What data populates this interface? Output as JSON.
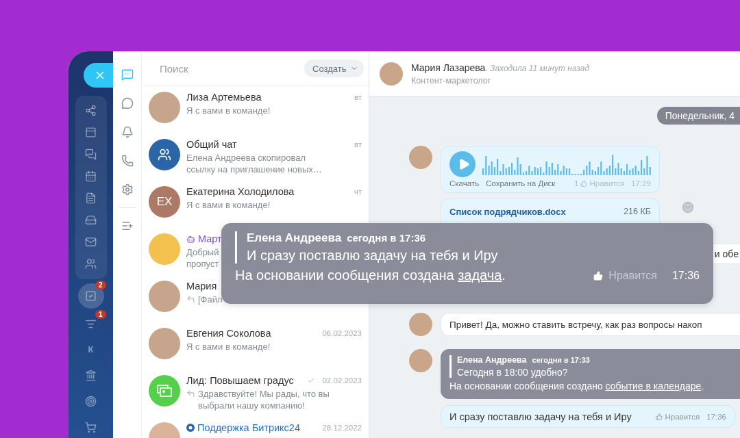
{
  "sidebar": {
    "items": [
      {
        "kind": "close"
      },
      {
        "kind": "group"
      },
      {
        "kind": "tasks",
        "badge": "2",
        "selected": true
      },
      {
        "kind": "filter",
        "badge": "1",
        "selected": false
      },
      {
        "kind": "letter",
        "label": "К",
        "selected": false
      },
      {
        "kind": "building",
        "selected": false
      },
      {
        "kind": "target",
        "selected": false
      },
      {
        "kind": "cart",
        "selected": false
      }
    ]
  },
  "icon_rail": [
    {
      "selected": true
    },
    {
      "selected": false
    },
    {
      "selected": false
    },
    {
      "selected": false
    },
    {
      "selected": false
    },
    {
      "selected": false
    }
  ],
  "chat_list": {
    "search": {
      "placeholder": "Поиск"
    },
    "create_button": "Создать",
    "items": [
      {
        "kind": "photo",
        "name": "Лиза Артемьева",
        "preview": [
          "Я с вами в команде!"
        ],
        "time": "вт",
        "reply": false,
        "read": false
      },
      {
        "kind": "group",
        "name": "Общий чат",
        "preview": [
          "Елена Андреева скопировал",
          "ссылку на приглашение новых…"
        ],
        "time": "вт",
        "reply": false,
        "read": false
      },
      {
        "kind": "initials",
        "initials": "ЕХ",
        "name": "Екатерина Холодилова",
        "preview": [
          "Я с вами в команде!"
        ],
        "time": "чт",
        "reply": false,
        "read": false
      },
      {
        "kind": "bot",
        "name": "Март",
        "preview": [
          "Добрый",
          "пропуст"
        ],
        "reply": false,
        "read": false
      },
      {
        "kind": "photo",
        "name": "Мария",
        "preview": [
          "[Файл"
        ],
        "reply": true,
        "read": false
      },
      {
        "kind": "photo",
        "name": "Евгения Соколова",
        "preview": [
          "Я с вами в команде!"
        ],
        "time": "06.02.2023",
        "reply": false,
        "read": false
      },
      {
        "kind": "lead",
        "name": "Лид: Повышаем градус",
        "preview": [
          "Здравствуйте! Мы рады, что вы",
          "выбрали нашу компанию!"
        ],
        "time": "02.02.2023",
        "reply": true,
        "read": true
      },
      {
        "kind": "support",
        "name": "Поддержка Битрикс24",
        "time": "28.12.2022",
        "reply": false,
        "read": false
      }
    ]
  },
  "chat": {
    "header": {
      "name": "Мария Лазарева",
      "status": ". Заходила 11 минут назад",
      "role": "Контент-маркетолог"
    },
    "messages": [
      {
        "kind": "date",
        "text": "Понедельник, 4"
      },
      {
        "kind": "voice",
        "avatar": true,
        "actions": [
          "Скачать",
          "Сохранить на Диск"
        ],
        "likes": "1",
        "like_label": "Нравится",
        "time": "17:29"
      },
      {
        "kind": "file",
        "avatar": false,
        "name": "Список подрядчиков.docx",
        "size": "216 КБ"
      },
      {
        "kind": "partial",
        "avatar": false,
        "text": "и обе"
      },
      {
        "kind": "text",
        "avatar": true,
        "text": "Привет! Да, можно ставить встречу, как раз вопросы накоп"
      },
      {
        "kind": "quote",
        "avatar": true,
        "author": "Елена Андреева",
        "when": "сегодня в 17:33",
        "quoted": "Сегодня в 18:00 удобно?",
        "note": "На основании сообщения создано ",
        "link": "событие в календаре",
        "tail": "."
      },
      {
        "kind": "own",
        "avatar": false,
        "text": "И сразу поставлю задачу на тебя и Иру",
        "like_label": "Нравится",
        "time": "17:36"
      }
    ]
  },
  "popup": {
    "author": "Елена Андреева",
    "when": "сегодня в 17:36",
    "quoted": "И сразу поставлю задачу на тебя и Иру",
    "note": "На основании сообщения создана ",
    "link": "задача",
    "tail": ".",
    "like_label": "Нравится",
    "time": "17:36"
  }
}
